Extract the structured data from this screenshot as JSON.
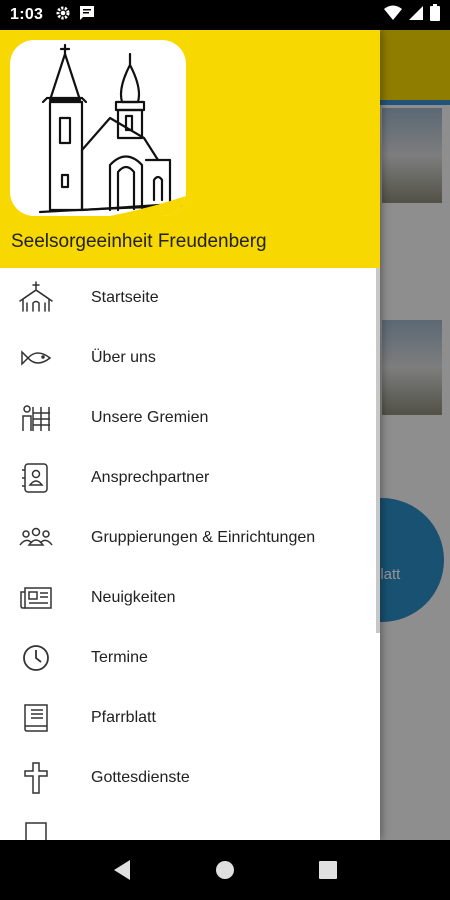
{
  "status_bar": {
    "time": "1:03",
    "icons": [
      "gear-icon",
      "message-icon",
      "wifi-icon",
      "signal-icon",
      "battery-icon"
    ]
  },
  "drawer": {
    "title": "Seelsorgeeinheit Freudenberg",
    "logo": "church-logo",
    "items": [
      {
        "label": "Startseite",
        "icon": "church-icon"
      },
      {
        "label": "Über uns",
        "icon": "fish-icon"
      },
      {
        "label": "Unsere Gremien",
        "icon": "committee-icon"
      },
      {
        "label": "Ansprechpartner",
        "icon": "contact-book-icon"
      },
      {
        "label": "Gruppierungen & Einrichtungen",
        "icon": "groups-icon"
      },
      {
        "label": "Neuigkeiten",
        "icon": "newspaper-icon"
      },
      {
        "label": "Termine",
        "icon": "clock-icon"
      },
      {
        "label": "Pfarrblatt",
        "icon": "book-icon"
      },
      {
        "label": "Gottesdienste",
        "icon": "cross-icon"
      }
    ]
  },
  "background": {
    "fab_label": "platt"
  },
  "colors": {
    "header_yellow": "#f7d800",
    "fab_blue": "#2a8cc4"
  }
}
